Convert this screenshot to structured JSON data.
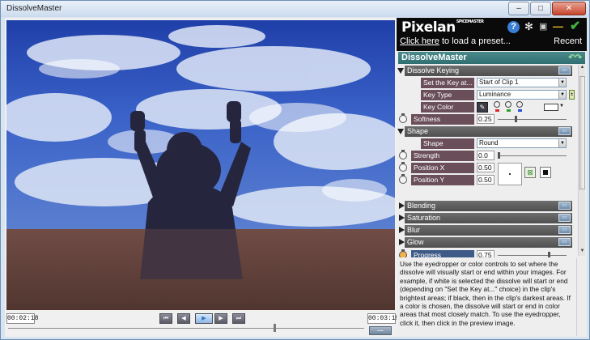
{
  "window": {
    "title": "DissolveMaster",
    "minimize": "–",
    "maximize": "□",
    "close": "✕"
  },
  "preview": {
    "start_time": "00:02:18",
    "end_time": "00:03:15",
    "controls": [
      "⏮",
      "◀",
      "▶",
      "▶",
      "⏭"
    ]
  },
  "panel": {
    "logo": "Pixelan",
    "logo_small": "SPICEMASTER",
    "preset_link": "Click here",
    "preset_text": " to load a preset...",
    "recent": "Recent",
    "title": "DissolveMaster",
    "sections": {
      "dissolve_keying": {
        "label": "Dissolve Keying",
        "set_key_label": "Set the Key at...",
        "set_key_value": "Start of Clip 1",
        "key_type_label": "Key Type",
        "key_type_value": "Luminance",
        "key_color_label": "Key Color",
        "softness_label": "Softness",
        "softness_value": "0.25",
        "softness_level": 0.25
      },
      "shape": {
        "label": "Shape",
        "shape_label": "Shape",
        "shape_value": "Round",
        "strength_label": "Strength",
        "strength_value": "0.0",
        "strength_level": 0.0,
        "position_x_label": "Position X",
        "position_x_value": "0.50",
        "position_y_label": "Position Y",
        "position_y_value": "0.50"
      },
      "collapsed": [
        "Blending",
        "Saturation",
        "Blur",
        "Glow"
      ],
      "progress_label": "Progress",
      "progress_value": "0.75",
      "progress_level": 0.75
    },
    "help_text": "Use the eyedropper or color controls to set where the dissolve will visually start or end within your images. For example, if white is selected the dissolve will start or end (depending on \"Set the Key at...\" choice) in the clip's brightest areas; if black, then in the clip's darkest areas.  If a color is chosen, the dissolve will start or end in color areas that most closely match. To use the eyedropper, click it, then click in the preview image."
  },
  "colors": {
    "title_bar": "#cbdbee",
    "panel_header": "#0a0a0a",
    "panel_title": "#2f6f72",
    "section_bar": "#555555",
    "param_label": "#6a4f5a",
    "progress_label": "#3e5a86",
    "check_green": "#3fb23f"
  }
}
